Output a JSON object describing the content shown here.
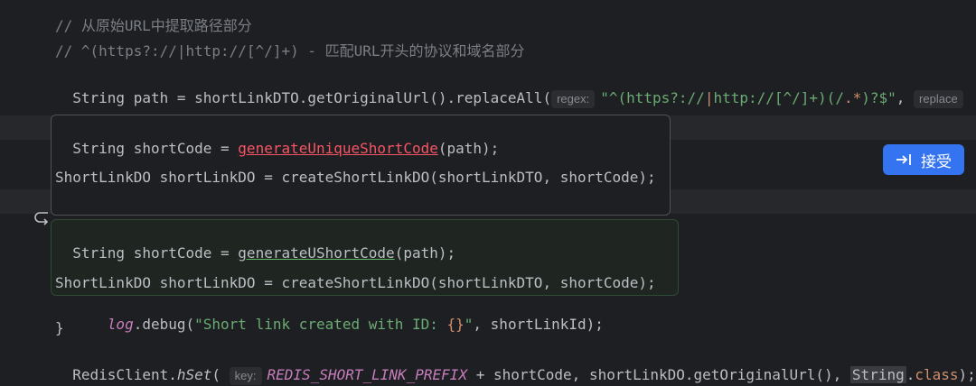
{
  "editor": {
    "comment1": "// 从原始URL中提取路径部分",
    "comment2": "// ^(https?://|http://[^/]+) - 匹配URL开头的协议和域名部分",
    "line3": {
      "type": "String",
      "rest1": " path = shortLinkDTO.getOriginalUrl().replaceAll(",
      "hint_regex": "regex:",
      "str_a": "\"^(https?://",
      "str_b": "|",
      "str_c": "http://[^/]+)(/",
      "str_d": ".*",
      "str_e": ")?$\"",
      "comma": ",",
      "hint_replace": "replace"
    },
    "old_line1": {
      "type": "String",
      "mid": " shortCode = ",
      "fn": "generateUniqueShortCode",
      "end": "(path);"
    },
    "old_line2": "ShortLinkDO shortLinkDO = createShortLinkDO(shortLinkDTO, shortCode);",
    "new_line1": {
      "type": "String",
      "mid": " shortCode = ",
      "fn": "generateUShortCode",
      "end": "(path);"
    },
    "new_line2": "ShortLinkDO shortLinkDO = createShortLinkDO(shortLinkDTO, shortCode);",
    "log_line": {
      "indent": "    ",
      "obj": "log",
      "call": ".debug(",
      "str1": "\"Short link created with ID: ",
      "brace": "{}",
      "str2": "\"",
      "rest": ", shortLinkId);"
    },
    "close_brace": "}",
    "redis_line": {
      "cls": "RedisClient.",
      "method": "hSet",
      "paren": "(",
      "hint_key": "key:",
      "const": "REDIS_SHORT_LINK_PREFIX",
      "mid": " + shortCode, shortLinkDO.getOriginalUrl(), ",
      "strcls": "String",
      "dot": ".",
      "kw_class": "class",
      "end": ");"
    }
  },
  "accept_button": {
    "label": "接受",
    "icon": "tab-arrow-icon",
    "color": "#3574f0"
  },
  "gutter": {
    "icon": "undo-arrow-icon"
  }
}
